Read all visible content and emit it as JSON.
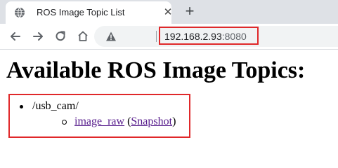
{
  "browser": {
    "tab": {
      "title": "ROS Image Topic List",
      "close_glyph": "✕"
    },
    "new_tab_glyph": "+",
    "toolbar": {
      "back_icon": "back-arrow-icon",
      "forward_icon": "forward-arrow-icon",
      "reload_icon": "reload-icon",
      "home_icon": "home-icon",
      "security_icon": "warning-triangle-icon"
    },
    "address": {
      "host": "192.168.2.93",
      "port": ":8080"
    }
  },
  "page": {
    "heading": "Available ROS Image Topics:",
    "topics": [
      {
        "name": "/usb_cam/",
        "streams": [
          {
            "link": "image_raw",
            "open_paren": "(",
            "snapshot_link": "Snapshot",
            "close_paren": ")"
          }
        ]
      }
    ]
  },
  "colors": {
    "highlight": "#e0282a",
    "visited_link": "#551a8b",
    "tabstrip": "#dee1e6",
    "omnibox": "#f1f3f4"
  }
}
